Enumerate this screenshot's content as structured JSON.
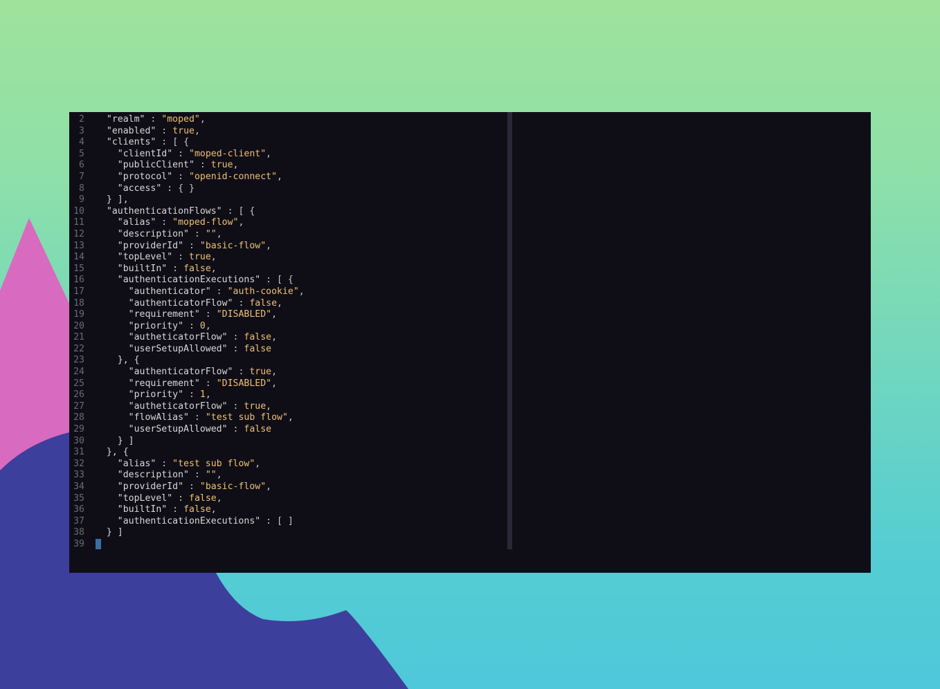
{
  "colors": {
    "terminal_bg": "#0f0e17",
    "key": "#d8d8d8",
    "value": "#f0c070",
    "line_number": "#6b6b78",
    "cursor": "#3a6ea8"
  },
  "editor": {
    "lines": [
      {
        "n": "2",
        "text": "  \"realm\" : \"moped\","
      },
      {
        "n": "3",
        "text": "  \"enabled\" : true,"
      },
      {
        "n": "4",
        "text": "  \"clients\" : [ {"
      },
      {
        "n": "5",
        "text": "    \"clientId\" : \"moped-client\","
      },
      {
        "n": "6",
        "text": "    \"publicClient\" : true,"
      },
      {
        "n": "7",
        "text": "    \"protocol\" : \"openid-connect\","
      },
      {
        "n": "8",
        "text": "    \"access\" : { }"
      },
      {
        "n": "9",
        "text": "  } ],"
      },
      {
        "n": "10",
        "text": "  \"authenticationFlows\" : [ {"
      },
      {
        "n": "11",
        "text": "    \"alias\" : \"moped-flow\","
      },
      {
        "n": "12",
        "text": "    \"description\" : \"\","
      },
      {
        "n": "13",
        "text": "    \"providerId\" : \"basic-flow\","
      },
      {
        "n": "14",
        "text": "    \"topLevel\" : true,"
      },
      {
        "n": "15",
        "text": "    \"builtIn\" : false,"
      },
      {
        "n": "16",
        "text": "    \"authenticationExecutions\" : [ {"
      },
      {
        "n": "17",
        "text": "      \"authenticator\" : \"auth-cookie\","
      },
      {
        "n": "18",
        "text": "      \"authenticatorFlow\" : false,"
      },
      {
        "n": "19",
        "text": "      \"requirement\" : \"DISABLED\","
      },
      {
        "n": "20",
        "text": "      \"priority\" : 0,"
      },
      {
        "n": "21",
        "text": "      \"autheticatorFlow\" : false,"
      },
      {
        "n": "22",
        "text": "      \"userSetupAllowed\" : false"
      },
      {
        "n": "23",
        "text": "    }, {"
      },
      {
        "n": "24",
        "text": "      \"authenticatorFlow\" : true,"
      },
      {
        "n": "25",
        "text": "      \"requirement\" : \"DISABLED\","
      },
      {
        "n": "26",
        "text": "      \"priority\" : 1,"
      },
      {
        "n": "27",
        "text": "      \"autheticatorFlow\" : true,"
      },
      {
        "n": "28",
        "text": "      \"flowAlias\" : \"test sub flow\","
      },
      {
        "n": "29",
        "text": "      \"userSetupAllowed\" : false"
      },
      {
        "n": "30",
        "text": "    } ]"
      },
      {
        "n": "31",
        "text": "  }, {"
      },
      {
        "n": "32",
        "text": "    \"alias\" : \"test sub flow\","
      },
      {
        "n": "33",
        "text": "    \"description\" : \"\","
      },
      {
        "n": "34",
        "text": "    \"providerId\" : \"basic-flow\","
      },
      {
        "n": "35",
        "text": "    \"topLevel\" : false,"
      },
      {
        "n": "36",
        "text": "    \"builtIn\" : false,"
      },
      {
        "n": "37",
        "text": "    \"authenticationExecutions\" : [ ]"
      },
      {
        "n": "38",
        "text": "  } ]"
      },
      {
        "n": "39",
        "text": "}"
      }
    ]
  }
}
